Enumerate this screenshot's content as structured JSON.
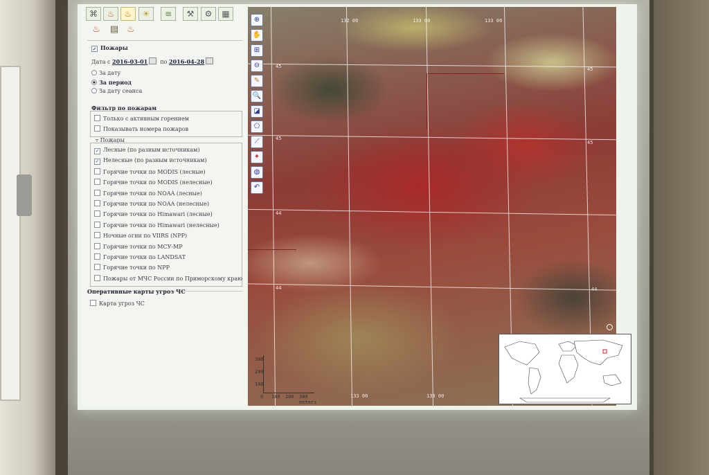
{
  "toolbar": {
    "tabs": [
      "layers-icon",
      "fire-icon",
      "fire-add-icon",
      "weather-icon",
      "stack-icon",
      "tools-icon",
      "settings-icon",
      "table-icon"
    ],
    "sub_icons": [
      "fire-red-icon",
      "report-icon",
      "fire-orange-icon"
    ]
  },
  "fires": {
    "header": "Пожары",
    "date_from_label": "Дата с",
    "date_from": "2016-03-01",
    "date_to_label": "по",
    "date_to": "2016-04-28",
    "modes": [
      {
        "label": "За дату",
        "selected": false
      },
      {
        "label": "За период",
        "selected": true
      },
      {
        "label": "За дату сеанса",
        "selected": false
      }
    ],
    "filter_title": "Фильтр по пожарам",
    "filter_items": [
      {
        "label": "Только с активным горением",
        "checked": false
      },
      {
        "label": "Показывать номера пожаров",
        "checked": false
      }
    ],
    "list_title": "Пожары",
    "list_items": [
      {
        "label": "Лесные (по разным источникам)",
        "checked": true
      },
      {
        "label": "Нелесные (по разным источникам)",
        "checked": true
      },
      {
        "label": "Горячие точки по MODIS (лесные)",
        "checked": false
      },
      {
        "label": "Горячие точки по MODIS (нелесные)",
        "checked": false
      },
      {
        "label": "Горячие точки по NOAA (лесные)",
        "checked": false
      },
      {
        "label": "Горячие точки по NOAA (нелесные)",
        "checked": false
      },
      {
        "label": "Горячие точки по Himawari (лесные)",
        "checked": false
      },
      {
        "label": "Горячие точки по Himawari (нелесные)",
        "checked": false
      },
      {
        "label": "Ночные огни по VIIRS (NPP)",
        "checked": false
      },
      {
        "label": "Горячие точки по МСУ-МР",
        "checked": false
      },
      {
        "label": "Горячие точки по LANDSAT",
        "checked": false
      },
      {
        "label": "Горячие точки по NPP",
        "checked": false
      },
      {
        "label": "Пожары от МЧС России по Приморскому краю",
        "checked": false
      }
    ]
  },
  "threats": {
    "title": "Оперативные карты угроз ЧС",
    "item": {
      "label": "Карта угроз ЧС",
      "checked": false
    }
  },
  "map": {
    "tools": [
      "zoom-in-icon",
      "pan-hand-icon",
      "zoom-box-icon",
      "zoom-out-icon",
      "ruler-icon",
      "zoom-layer-icon",
      "select-icon",
      "polygon-icon",
      "line-icon",
      "point-icon",
      "globe-icon",
      "undo-icon"
    ],
    "top_labels": [
      "132 00",
      "133 00",
      "133 00"
    ],
    "bottom_labels": [
      "133 00",
      "133 00"
    ],
    "left_labels": [
      "45",
      "45",
      "44",
      "44"
    ],
    "right_labels": [
      "45",
      "45",
      "44"
    ],
    "scale_ticks": [
      "300",
      "200",
      "100"
    ],
    "scale_bottom": [
      "0",
      "100",
      "200",
      "300 meters"
    ]
  },
  "colors": {
    "accent": "#3a4d9a",
    "fire_red": "#b3352f",
    "panel_bg": "#f3f6f0"
  }
}
